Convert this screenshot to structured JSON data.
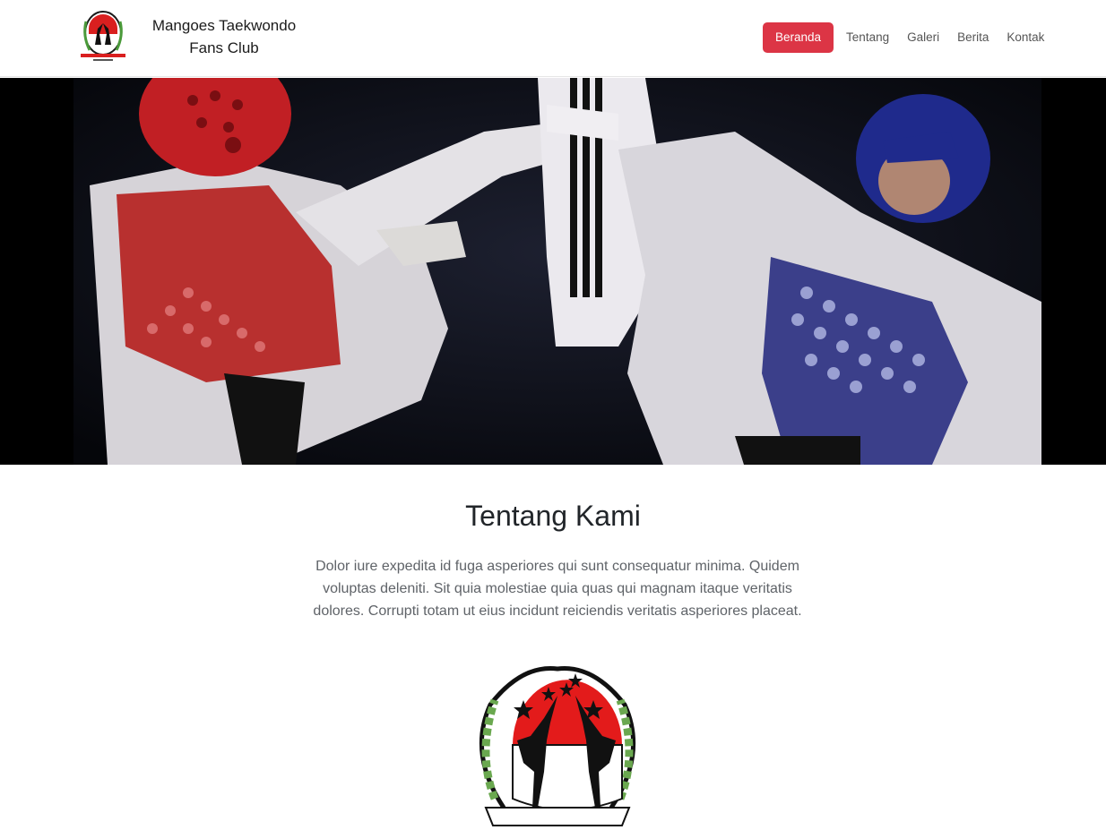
{
  "brand": {
    "name": "Mangoes Taekwondo Fans Club"
  },
  "nav": {
    "items": [
      {
        "label": "Beranda",
        "active": true
      },
      {
        "label": "Tentang",
        "active": false
      },
      {
        "label": "Galeri",
        "active": false
      },
      {
        "label": "Berita",
        "active": false
      },
      {
        "label": "Kontak",
        "active": false
      }
    ]
  },
  "hero": {
    "image": "taekwondo-sparring-photo"
  },
  "about": {
    "title": "Tentang Kami",
    "text": "Dolor iure expedita id fuga asperiores qui sunt consequatur minima. Quidem voluptas deleniti. Sit quia molestiae quia quas qui magnam itaque veritatis dolores. Corrupti totam ut eius incidunt reiciendis veritatis asperiores placeat."
  },
  "colors": {
    "accent": "#dc3545",
    "text": "#212529",
    "muted": "#5f6368"
  }
}
